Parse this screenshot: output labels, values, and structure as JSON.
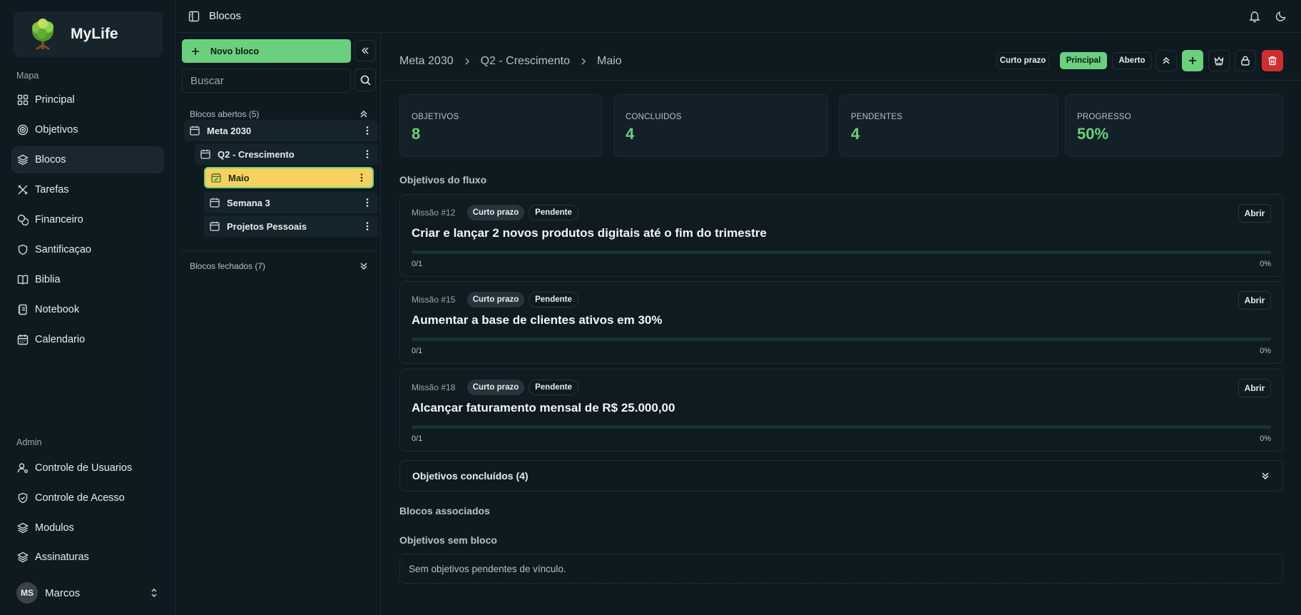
{
  "app": {
    "name": "MyLife"
  },
  "nav": {
    "section_main": "Mapa",
    "items": [
      {
        "label": "Principal",
        "icon": "grid-icon"
      },
      {
        "label": "Objetivos",
        "icon": "target-icon"
      },
      {
        "label": "Blocos",
        "icon": "layers-icon",
        "active": true
      },
      {
        "label": "Tarefas",
        "icon": "tasks-icon"
      },
      {
        "label": "Financeiro",
        "icon": "coins-icon"
      },
      {
        "label": "Santificaçao",
        "icon": "shield-icon"
      },
      {
        "label": "Biblia",
        "icon": "book-icon"
      },
      {
        "label": "Notebook",
        "icon": "notebook-icon"
      },
      {
        "label": "Calendario",
        "icon": "calendar-icon"
      }
    ],
    "section_admin": "Admin",
    "admin_items": [
      {
        "label": "Controle de Usuarios",
        "icon": "user-cog-icon"
      },
      {
        "label": "Controle de Acesso",
        "icon": "shield-check-icon"
      },
      {
        "label": "Modulos",
        "icon": "layers-icon"
      },
      {
        "label": "Assinaturas",
        "icon": "layers-icon"
      }
    ],
    "user": {
      "initials": "MS",
      "name": "Marcos"
    }
  },
  "topbar": {
    "title": "Blocos"
  },
  "tree": {
    "new_button": "Novo bloco",
    "search_placeholder": "Buscar",
    "open_group": "Blocos abertos (5)",
    "closed_group": "Blocos fechados (7)",
    "items": [
      {
        "label": "Meta 2030"
      },
      {
        "label": "Q2 - Crescimento"
      },
      {
        "label": "Maio",
        "selected": true
      },
      {
        "label": "Semana 3"
      },
      {
        "label": "Projetos Pessoais"
      }
    ]
  },
  "main": {
    "breadcrumb": [
      "Meta 2030",
      "Q2 - Crescimento",
      "Maio"
    ],
    "tags": [
      "Curto prazo",
      "Principal",
      "Aberto"
    ],
    "stats": [
      {
        "label": "OBJETIVOS",
        "value": "8"
      },
      {
        "label": "CONCLUIDOS",
        "value": "4"
      },
      {
        "label": "PENDENTES",
        "value": "4"
      },
      {
        "label": "PROGRESSO",
        "value": "50%"
      }
    ],
    "flow_title": "Objetivos do fluxo",
    "cards": [
      {
        "mission": "Missão #12",
        "term": "Curto prazo",
        "status": "Pendente",
        "open": "Abrir",
        "title": "Criar e lançar 2 novos produtos digitais até o fim do trimestre",
        "count": "0/1",
        "percent": "0%",
        "progress": 0
      },
      {
        "mission": "Missão #15",
        "term": "Curto prazo",
        "status": "Pendente",
        "open": "Abrir",
        "title": "Aumentar a base de clientes ativos em 30%",
        "count": "0/1",
        "percent": "0%",
        "progress": 0
      },
      {
        "mission": "Missão #18",
        "term": "Curto prazo",
        "status": "Pendente",
        "open": "Abrir",
        "title": "Alcançar faturamento mensal de R$ 25.000,00",
        "count": "0/1",
        "percent": "0%",
        "progress": 0
      }
    ],
    "completed_label": "Objetivos concluídos (4)",
    "associated_title": "Blocos associados",
    "unlinked_title": "Objetivos sem bloco",
    "unlinked_empty": "Sem objetivos pendentes de vínculo."
  },
  "colors": {
    "accent": "#6ad07e",
    "selected": "#f6d15e",
    "danger": "#cf2e2e",
    "background": "#0f1a20"
  }
}
